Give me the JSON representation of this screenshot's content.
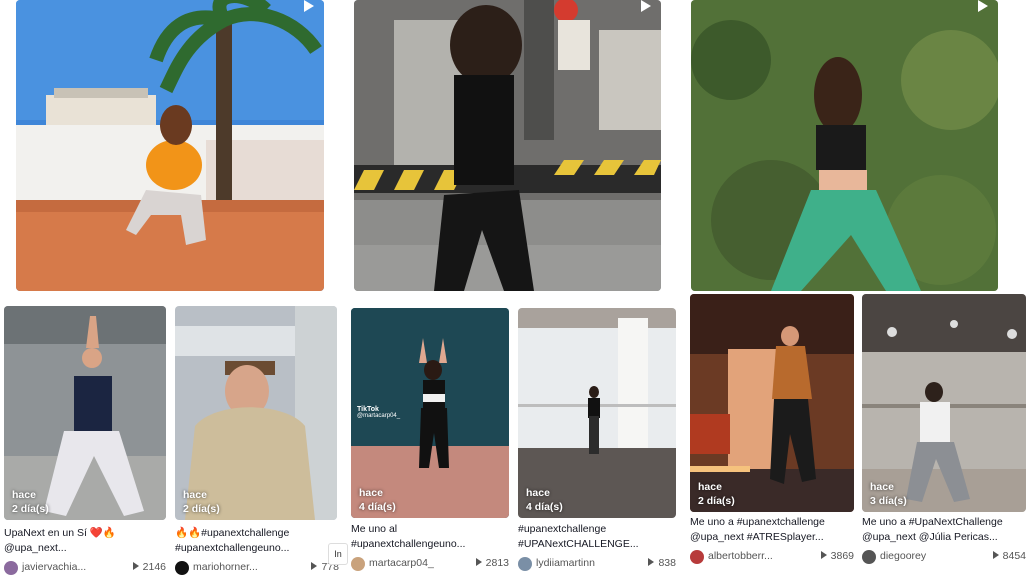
{
  "videos_top": [
    {
      "id": "v1"
    },
    {
      "id": "v2"
    },
    {
      "id": "v3"
    }
  ],
  "videos": [
    {
      "badge_top": "hace",
      "badge_bottom": "2 día(s)",
      "caption1": "UpaNext en un Sí ❤️🔥",
      "caption2": "@upa_next...",
      "user": "javiervachia...",
      "views": "2146"
    },
    {
      "badge_top": "hace",
      "badge_bottom": "2 día(s)",
      "caption1": "🔥🔥#upanextchallenge",
      "caption2": "#upanextchallengeuno...",
      "user": "mariohorner...",
      "views": "778"
    },
    {
      "badge_top": "hace",
      "badge_bottom": "4 día(s)",
      "caption1": "Me uno al",
      "caption2": "#upanextchallengeuno...",
      "user": "martacarp04_",
      "views": "2813"
    },
    {
      "badge_top": "hace",
      "badge_bottom": "4 día(s)",
      "caption1": "#upanextchallenge",
      "caption2": "#UPANextCHALLENGE...",
      "user": "lydiiamartinn",
      "views": "838"
    },
    {
      "badge_top": "hace",
      "badge_bottom": "2 día(s)",
      "caption1": "Me uno a #upanextchallenge",
      "caption2": "@upa_next #ATRESplayer...",
      "user": "albertobberr...",
      "views": "3869"
    },
    {
      "badge_top": "hace",
      "badge_bottom": "3 día(s)",
      "caption1": "Me uno a #UpaNextChallenge",
      "caption2": "@upa_next @Júlia Pericas...",
      "user": "diegoorey",
      "views": "8454"
    }
  ],
  "watermark": {
    "brand": "TikTok",
    "handle": "@martacarp04_"
  },
  "more_label": "In"
}
